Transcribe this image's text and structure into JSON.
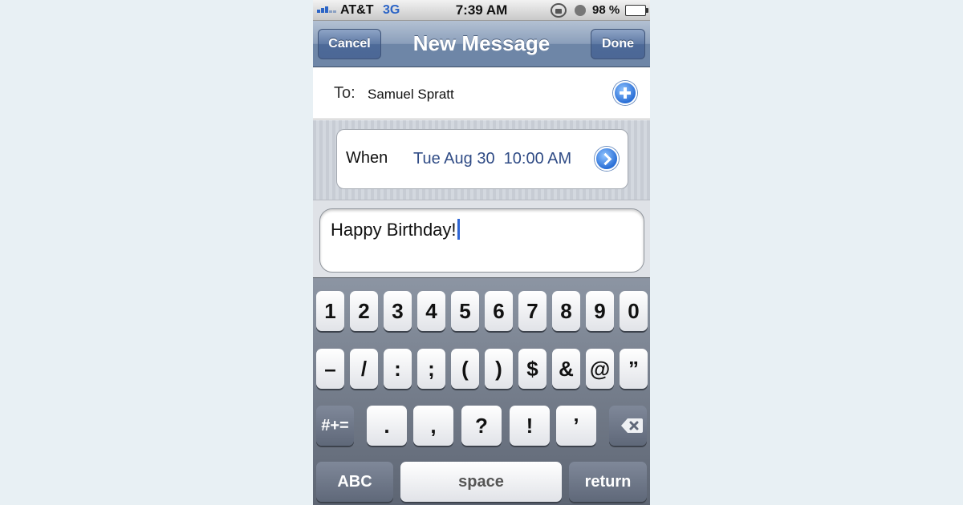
{
  "status_bar": {
    "carrier": "AT&T",
    "network": "3G",
    "time": "7:39 AM",
    "battery_percent": "98 %",
    "battery_level": 0.98,
    "icons": [
      "signal-icon",
      "orientation-lock-icon",
      "alarm-icon",
      "battery-icon"
    ]
  },
  "nav": {
    "title": "New Message",
    "cancel_label": "Cancel",
    "done_label": "Done"
  },
  "recipient": {
    "label": "To:",
    "value": "Samuel Spratt",
    "add_icon": "add-contact-icon"
  },
  "schedule": {
    "label": "When",
    "value": "Tue Aug 30  10:00 AM",
    "detail_icon": "chevron-right-icon"
  },
  "message": {
    "text": "Happy Birthday!"
  },
  "keyboard": {
    "row1": [
      "1",
      "2",
      "3",
      "4",
      "5",
      "6",
      "7",
      "8",
      "9",
      "0"
    ],
    "row2": [
      "–",
      "/",
      ":",
      ";",
      "(",
      ")",
      "$",
      "&",
      "@",
      "”"
    ],
    "row3_mode": "#+=",
    "row3": [
      ".",
      ",",
      "?",
      "!",
      "’"
    ],
    "backspace_icon": "backspace-icon",
    "abc_label": "ABC",
    "space_label": "space",
    "return_label": "return"
  },
  "colors": {
    "accent_blue": "#2a6fd6",
    "nav_bar": "#6e86a7",
    "when_value": "#304c86"
  }
}
